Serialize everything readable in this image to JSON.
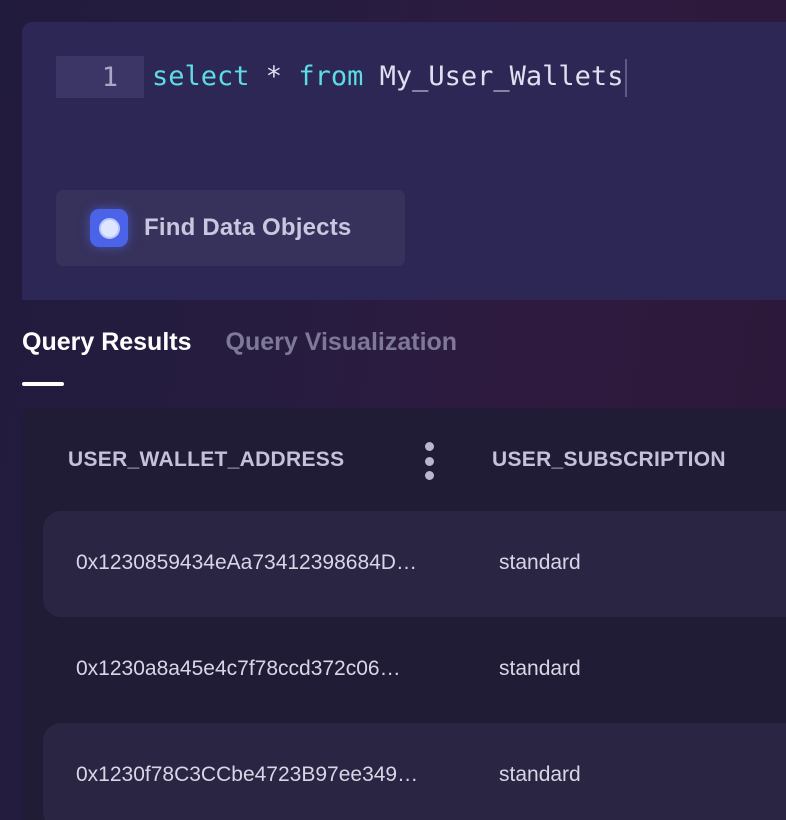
{
  "editor": {
    "line_number": "1",
    "query": {
      "kw_select": "select",
      "star": " * ",
      "kw_from": "from",
      "table": " My_User_Wallets"
    },
    "find_button_label": "Find Data Objects",
    "find_icon": "search-icon"
  },
  "tabs": [
    {
      "label": "Query Results",
      "active": true
    },
    {
      "label": "Query Visualization",
      "active": false
    }
  ],
  "results": {
    "columns": [
      "USER_WALLET_ADDRESS",
      "USER_SUBSCRIPTION"
    ],
    "rows": [
      {
        "wallet": "0x1230859434eAa73412398684D…",
        "subscription": "standard"
      },
      {
        "wallet": "0x1230a8a45e4c7f78ccd372c06…",
        "subscription": "standard"
      },
      {
        "wallet": "0x1230f78C3CCbe4723B97ee349…",
        "subscription": "standard"
      }
    ]
  },
  "colors": {
    "keyword": "#5fdbe6",
    "accent_icon": "#4a63e8",
    "active_tab": "#ffffff",
    "inactive_tab": "#7d7996"
  }
}
